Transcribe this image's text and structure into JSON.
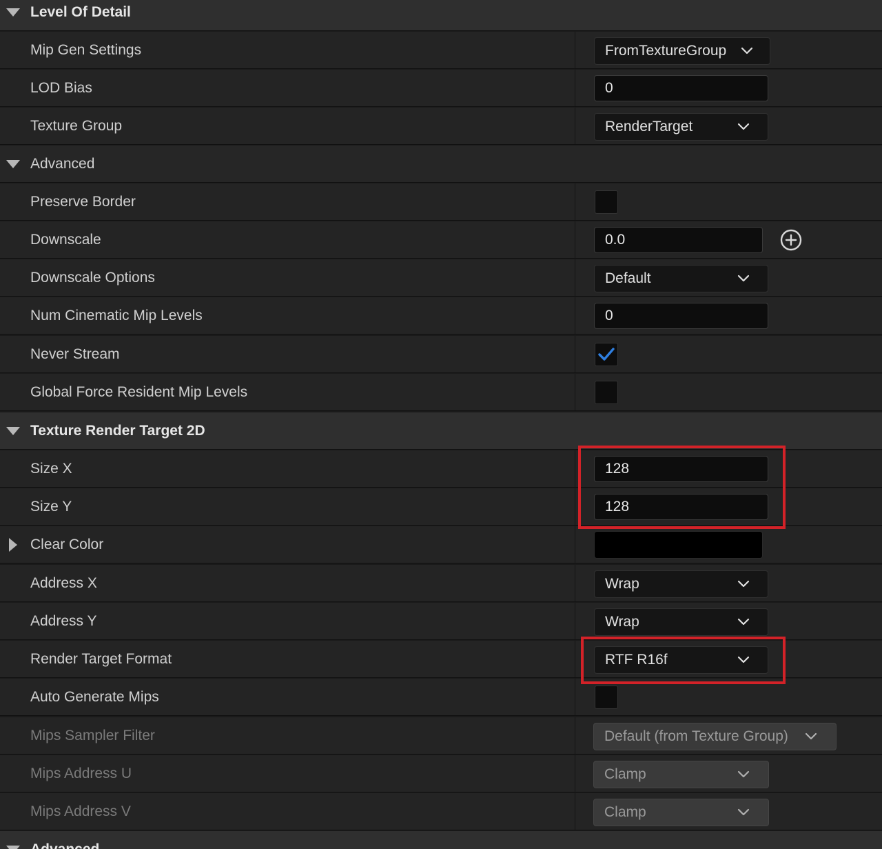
{
  "sections": {
    "level_of_detail": "Level Of Detail",
    "advanced": "Advanced",
    "texture_render_target": "Texture Render Target 2D",
    "advanced_bottom": "Advanced"
  },
  "rows": {
    "mip_gen_settings": {
      "label": "Mip Gen Settings",
      "value": "FromTextureGroup"
    },
    "lod_bias": {
      "label": "LOD Bias",
      "value": "0"
    },
    "texture_group": {
      "label": "Texture Group",
      "value": "RenderTarget"
    },
    "preserve_border": {
      "label": "Preserve Border",
      "checked": false
    },
    "downscale": {
      "label": "Downscale",
      "value": "0.0"
    },
    "downscale_options": {
      "label": "Downscale Options",
      "value": "Default"
    },
    "num_cinematic_mip_levels": {
      "label": "Num Cinematic Mip Levels",
      "value": "0"
    },
    "never_stream": {
      "label": "Never Stream",
      "checked": true
    },
    "global_force_resident": {
      "label": "Global Force Resident Mip Levels",
      "checked": false
    },
    "size_x": {
      "label": "Size X",
      "value": "128"
    },
    "size_y": {
      "label": "Size Y",
      "value": "128"
    },
    "clear_color": {
      "label": "Clear Color",
      "color": "#000000"
    },
    "address_x": {
      "label": "Address X",
      "value": "Wrap"
    },
    "address_y": {
      "label": "Address Y",
      "value": "Wrap"
    },
    "render_target_format": {
      "label": "Render Target Format",
      "value": "RTF R16f"
    },
    "auto_generate_mips": {
      "label": "Auto Generate Mips",
      "checked": false
    },
    "mips_sampler_filter": {
      "label": "Mips Sampler Filter",
      "value": "Default (from Texture Group)"
    },
    "mips_address_u": {
      "label": "Mips Address U",
      "value": "Clamp"
    },
    "mips_address_v": {
      "label": "Mips Address V",
      "value": "Clamp"
    }
  },
  "icons": {
    "expand": "triangle-down-icon",
    "collapse": "triangle-right-icon",
    "dropdown": "chevron-down-icon",
    "add": "plus-circle-icon",
    "check": "checkmark-icon"
  },
  "colors": {
    "check_accent": "#2f7fe0",
    "highlight": "#d32228"
  }
}
